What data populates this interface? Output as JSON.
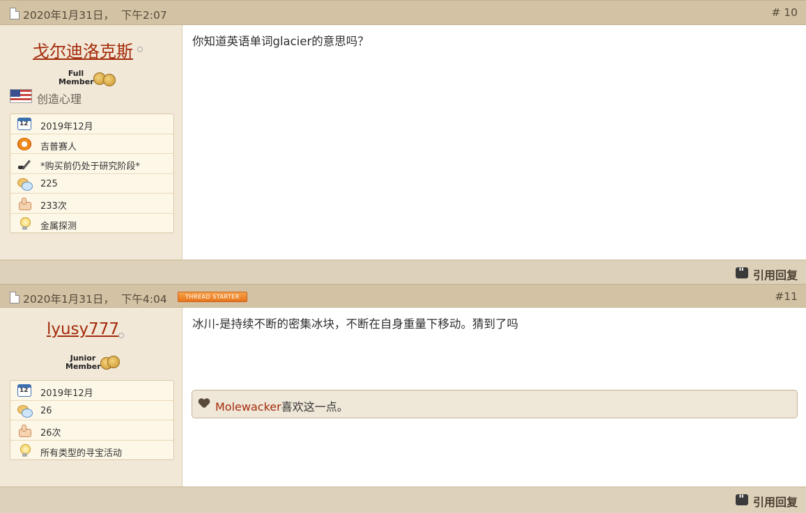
{
  "posts": [
    {
      "date": "2020年1月31日，  下午2:07",
      "number": "# 10",
      "username": "戈尔迪洛克斯",
      "rank": [
        "Full",
        "Member"
      ],
      "location": "创造心理",
      "info": [
        {
          "icon": "calendar-icon",
          "text": "2019年12月"
        },
        {
          "icon": "compass-icon",
          "text": "吉普赛人"
        },
        {
          "icon": "metal-detector-icon",
          "text": "*购买前仍处于研究阶段*"
        },
        {
          "icon": "chat-icon",
          "text": "225"
        },
        {
          "icon": "thumbs-up-icon",
          "text": "233次"
        },
        {
          "icon": "lightbulb-icon",
          "text": "金属探测"
        }
      ],
      "message": "你知道英语单词glacier的意思吗？",
      "reply_label": "引用回复"
    },
    {
      "date": "2020年1月31日，  下午4:04",
      "badge": "THREAD STARTER",
      "number": "#11",
      "username": "lyusy777",
      "rank": [
        "Junior",
        "Member"
      ],
      "info": [
        {
          "icon": "calendar-icon",
          "text": "2019年12月"
        },
        {
          "icon": "chat-icon",
          "text": "26"
        },
        {
          "icon": "thumbs-up-icon",
          "text": "26次"
        },
        {
          "icon": "lightbulb-icon",
          "text": "所有类型的寻宝活动"
        }
      ],
      "message": "冰川-是持续不断的密集冰块，不断在自身重量下移动。猜到了吗",
      "likes": {
        "user": "Molewacker",
        "suffix": "喜欢这一点。"
      },
      "reply_label": "引用回复"
    }
  ],
  "colors": {
    "accent_link": "#a52a0a",
    "header_bg": "#d3c3a4",
    "badge_orange": "#f0892f"
  }
}
